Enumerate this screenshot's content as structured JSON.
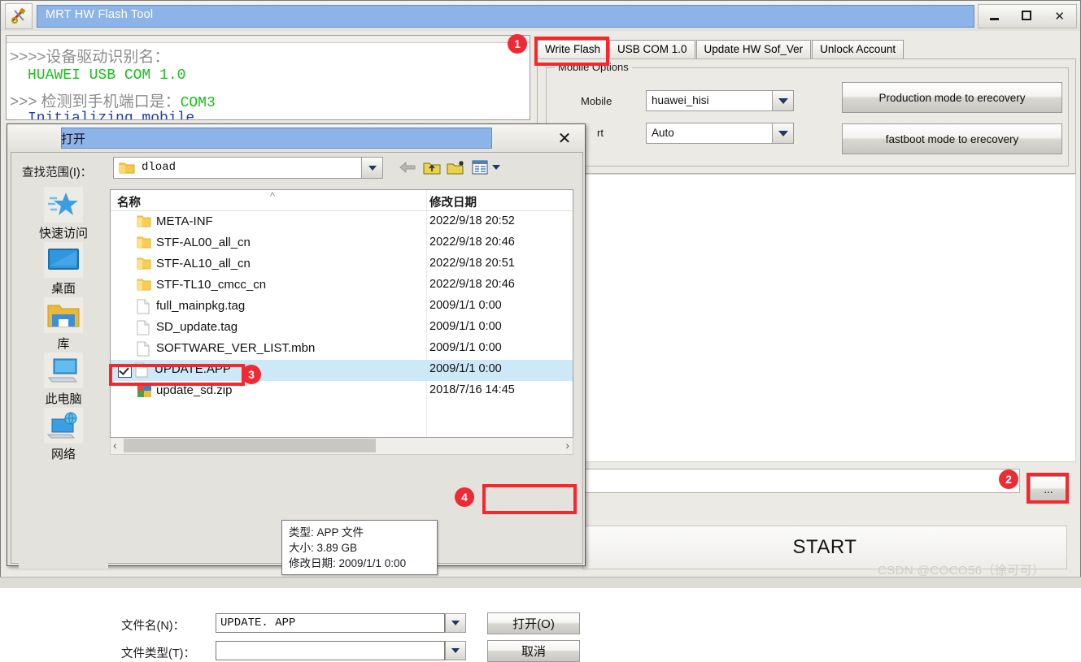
{
  "app": {
    "title": "MRT HW Flash Tool",
    "icon": "tools-icon",
    "window_buttons": [
      {
        "name": "minimize-button",
        "glyph": "_"
      },
      {
        "name": "maximize-button",
        "glyph": "☐"
      },
      {
        "name": "close-button",
        "glyph": "✕"
      }
    ]
  },
  "log": {
    "line1": ">>>>设备驱动识别名：",
    "line2": "HUAWEI USB COM 1.0",
    "line3_prefix": ">>> 检测到手机端口是：",
    "line3_port": "COM3",
    "line4": "Initializing mobile..."
  },
  "tabs": [
    {
      "label": "Write Flash",
      "active": true
    },
    {
      "label": "USB COM 1.0",
      "active": false
    },
    {
      "label": "Update HW Sof_Ver",
      "active": false
    },
    {
      "label": "Unlock Account",
      "active": false
    }
  ],
  "mobile_options": {
    "group_title": "Mobile Options",
    "mobile_label": "Mobile",
    "mobile_value": "huawei_hisi",
    "port_label": "rt",
    "port_value": "Auto",
    "buttons": [
      {
        "name": "production-mode-button",
        "label": "Production mode to erecovery"
      },
      {
        "name": "fastboot-mode-button",
        "label": "fastboot mode to erecovery"
      }
    ]
  },
  "bottom": {
    "path_value": "",
    "browse_label": "...",
    "start_label": "START",
    "watermark": "CSDN @COCO56（徐可可）"
  },
  "dialog": {
    "title": "打开",
    "close_glyph": "✕",
    "lookin_label": "查找范围(I)：",
    "lookin_value": "dload",
    "toolbar": [
      {
        "name": "back-arrow-icon"
      },
      {
        "name": "up-folder-icon"
      },
      {
        "name": "new-folder-icon"
      },
      {
        "name": "view-mode-icon"
      }
    ],
    "places": [
      {
        "name": "quick-access",
        "label": "快速访问",
        "icon": "star-icon"
      },
      {
        "name": "desktop",
        "label": "桌面",
        "icon": "monitor-icon"
      },
      {
        "name": "libraries",
        "label": "库",
        "icon": "folder-icon"
      },
      {
        "name": "this-pc",
        "label": "此电脑",
        "icon": "computer-icon"
      },
      {
        "name": "network",
        "label": "网络",
        "icon": "network-icon"
      }
    ],
    "columns": {
      "name": "名称",
      "date": "修改日期"
    },
    "files": [
      {
        "name": "META-INF",
        "date": "2022/9/18 20:52",
        "type": "folder",
        "selected": false,
        "checked": false
      },
      {
        "name": "STF-AL00_all_cn",
        "date": "2022/9/18 20:46",
        "type": "folder",
        "selected": false,
        "checked": false
      },
      {
        "name": "STF-AL10_all_cn",
        "date": "2022/9/18 20:51",
        "type": "folder",
        "selected": false,
        "checked": false
      },
      {
        "name": "STF-TL10_cmcc_cn",
        "date": "2022/9/18 20:46",
        "type": "folder",
        "selected": false,
        "checked": false
      },
      {
        "name": "full_mainpkg.tag",
        "date": "2009/1/1 0:00",
        "type": "file",
        "selected": false,
        "checked": false
      },
      {
        "name": "SD_update.tag",
        "date": "2009/1/1 0:00",
        "type": "file",
        "selected": false,
        "checked": false
      },
      {
        "name": "SOFTWARE_VER_LIST.mbn",
        "date": "2009/1/1 0:00",
        "type": "file",
        "selected": false,
        "checked": false
      },
      {
        "name": "UPDATE.APP",
        "date": "2009/1/1 0:00",
        "type": "file",
        "selected": true,
        "checked": true
      },
      {
        "name": "update_sd.zip",
        "date": "2018/7/16 14:45",
        "type": "zip",
        "selected": false,
        "checked": false
      }
    ],
    "tooltip": {
      "type": "类型: APP 文件",
      "size": "大小: 3.89 GB",
      "modified": "修改日期: 2009/1/1 0:00"
    },
    "filename_label": "文件名(N)：",
    "filename_value": "UPDATE. APP",
    "filetype_label": "文件类型(T)：",
    "filetype_value": "",
    "open_button": "打开(O)",
    "cancel_button": "取消"
  },
  "annotations": [
    {
      "num": "1",
      "target": "write-flash-tab"
    },
    {
      "num": "2",
      "target": "browse-button"
    },
    {
      "num": "3",
      "target": "update-app-row"
    },
    {
      "num": "4",
      "target": "open-button"
    }
  ],
  "colors": {
    "accent_red": "#ef2a34",
    "title_blue": "#8cb4e8",
    "log_green": "#16c216",
    "log_blue": "#1c39c7",
    "selection_blue": "#cde8f7"
  }
}
